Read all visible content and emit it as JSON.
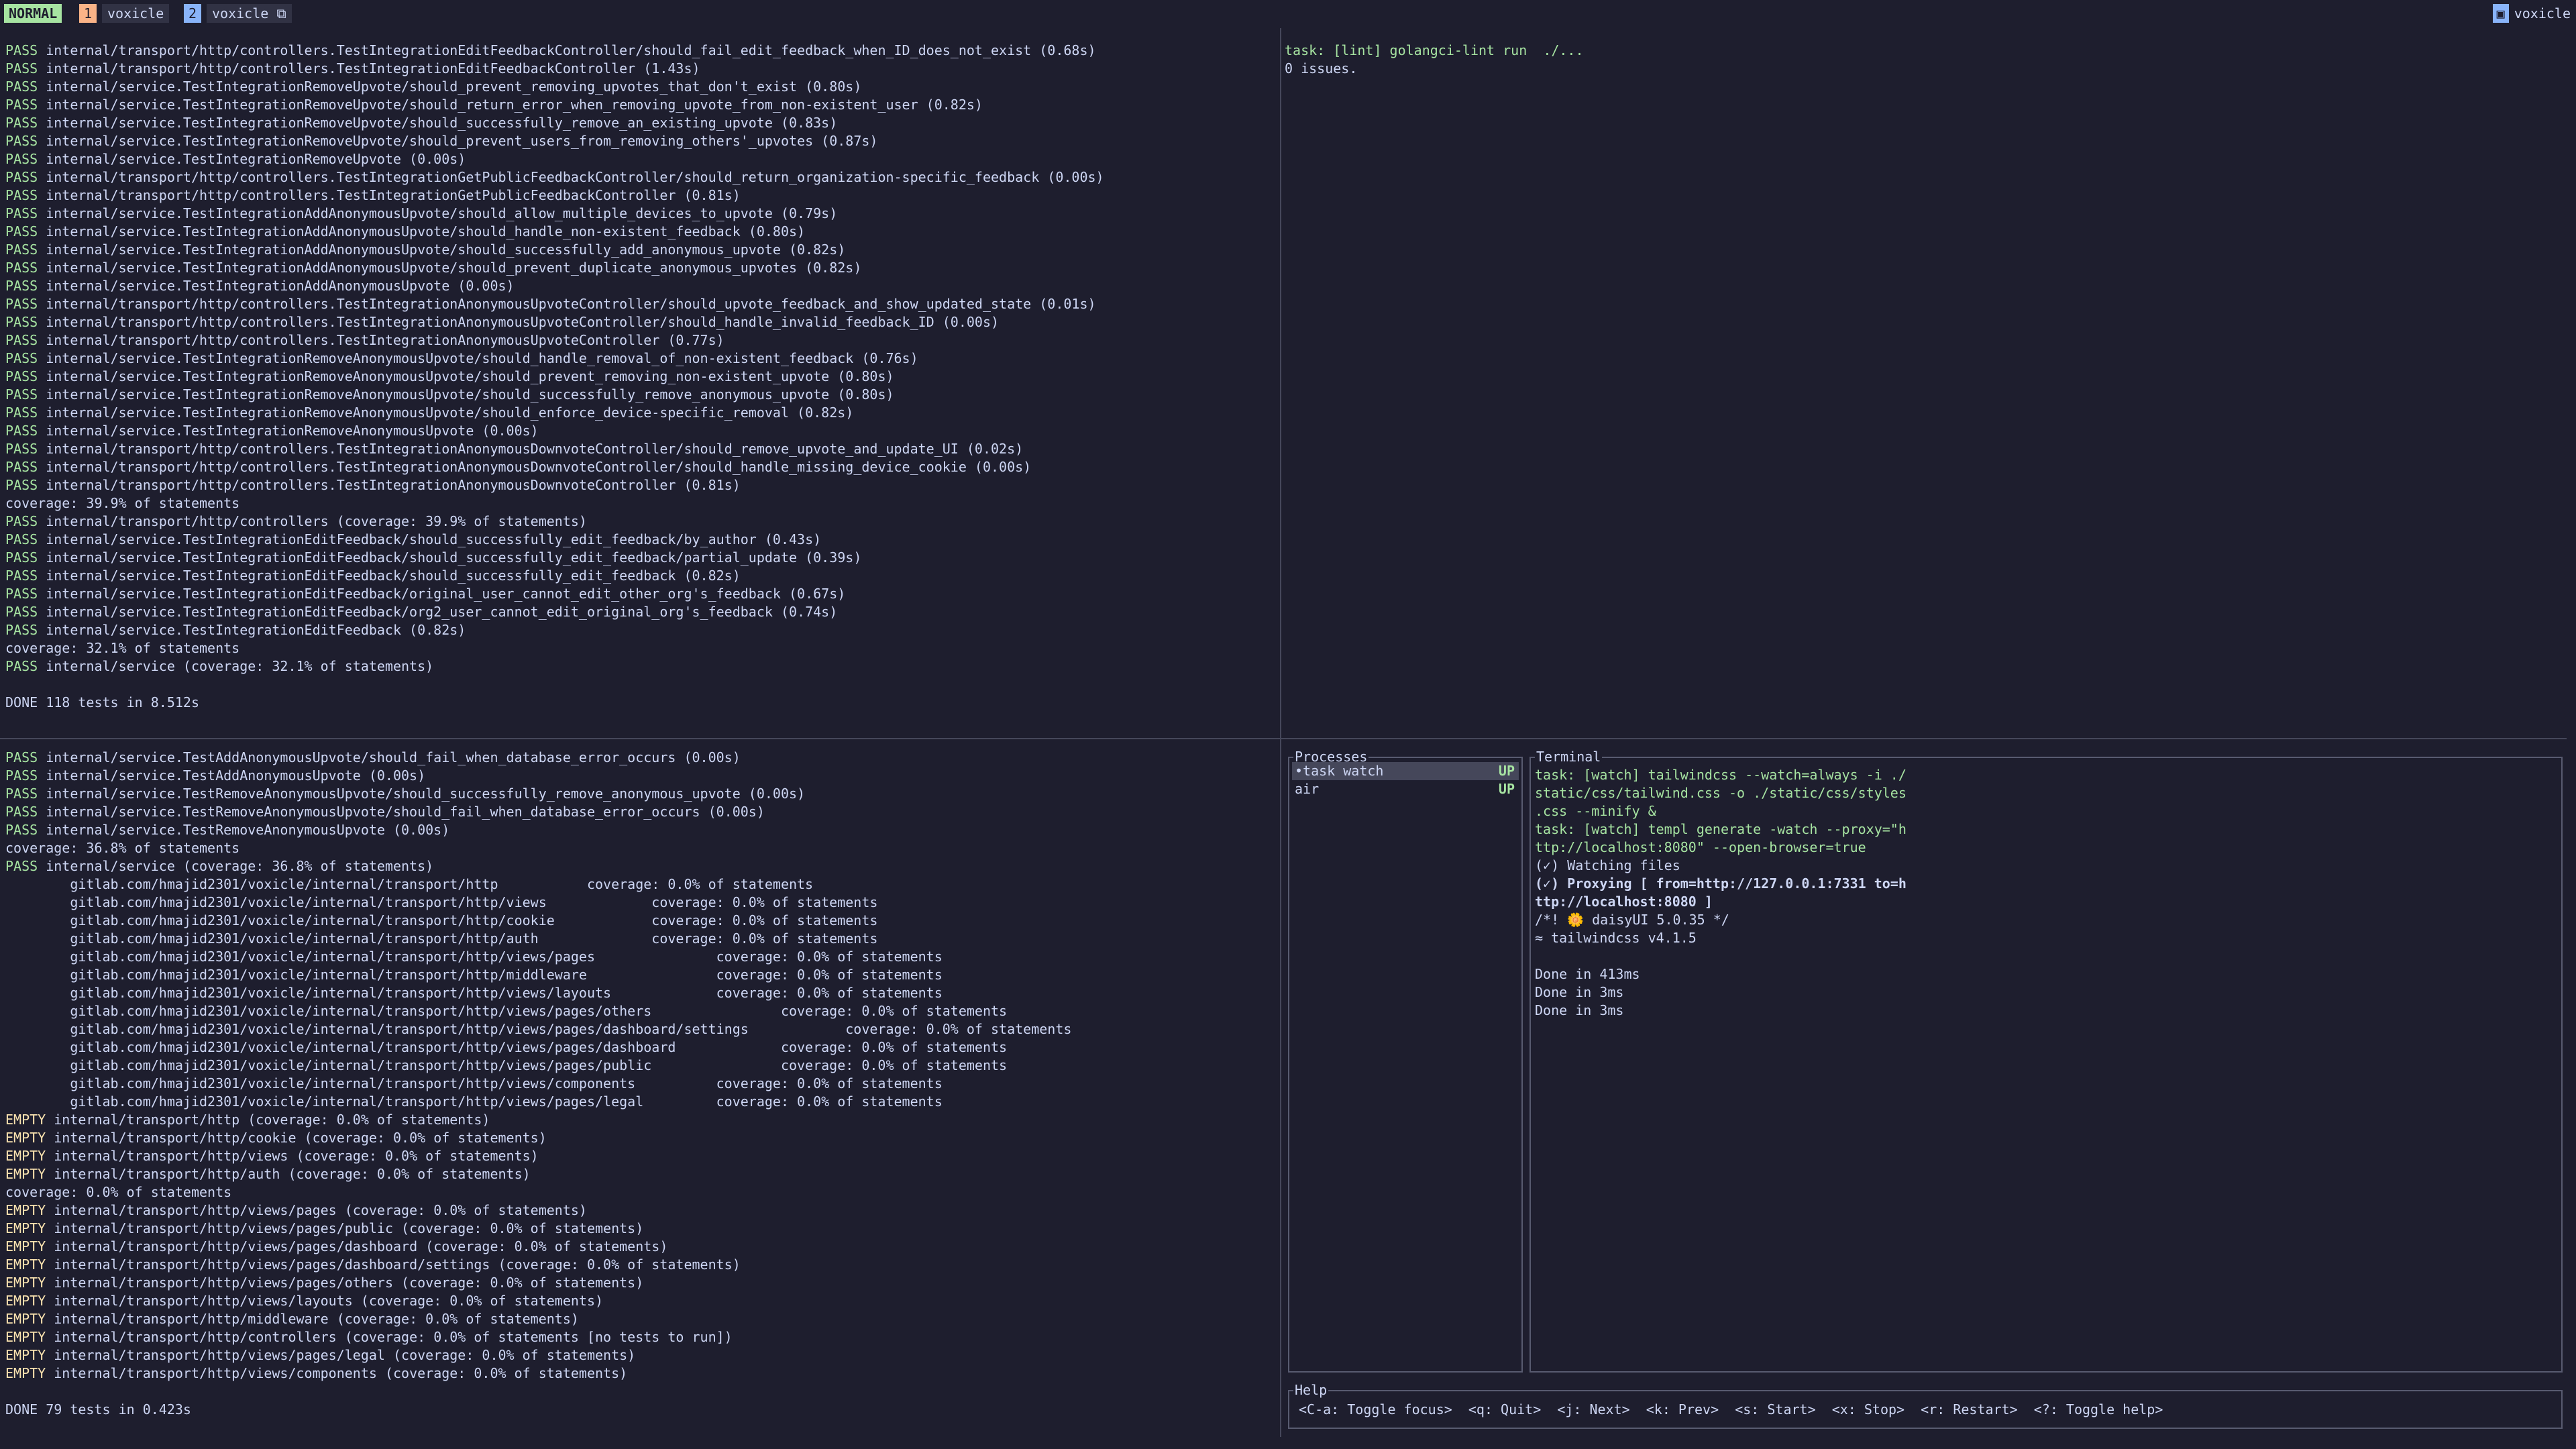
{
  "topbar": {
    "mode": "NORMAL",
    "window1_num": "1",
    "window1_name": "voxicle",
    "window2_num": "2",
    "window2_name": "voxicle ⧉",
    "session_icon": "▣",
    "session_name": "voxicle"
  },
  "top_left_lines": [
    {
      "s": "PASS",
      "t": " internal/transport/http/controllers.TestIntegrationEditFeedbackController/should_fail_edit_feedback_when_ID_does_not_exist (0.68s)"
    },
    {
      "s": "PASS",
      "t": " internal/transport/http/controllers.TestIntegrationEditFeedbackController (1.43s)"
    },
    {
      "s": "PASS",
      "t": " internal/service.TestIntegrationRemoveUpvote/should_prevent_removing_upvotes_that_don't_exist (0.80s)"
    },
    {
      "s": "PASS",
      "t": " internal/service.TestIntegrationRemoveUpvote/should_return_error_when_removing_upvote_from_non-existent_user (0.82s)"
    },
    {
      "s": "PASS",
      "t": " internal/service.TestIntegrationRemoveUpvote/should_successfully_remove_an_existing_upvote (0.83s)"
    },
    {
      "s": "PASS",
      "t": " internal/service.TestIntegrationRemoveUpvote/should_prevent_users_from_removing_others'_upvotes (0.87s)"
    },
    {
      "s": "PASS",
      "t": " internal/service.TestIntegrationRemoveUpvote (0.00s)"
    },
    {
      "s": "PASS",
      "t": " internal/transport/http/controllers.TestIntegrationGetPublicFeedbackController/should_return_organization-specific_feedback (0.00s)"
    },
    {
      "s": "PASS",
      "t": " internal/transport/http/controllers.TestIntegrationGetPublicFeedbackController (0.81s)"
    },
    {
      "s": "PASS",
      "t": " internal/service.TestIntegrationAddAnonymousUpvote/should_allow_multiple_devices_to_upvote (0.79s)"
    },
    {
      "s": "PASS",
      "t": " internal/service.TestIntegrationAddAnonymousUpvote/should_handle_non-existent_feedback (0.80s)"
    },
    {
      "s": "PASS",
      "t": " internal/service.TestIntegrationAddAnonymousUpvote/should_successfully_add_anonymous_upvote (0.82s)"
    },
    {
      "s": "PASS",
      "t": " internal/service.TestIntegrationAddAnonymousUpvote/should_prevent_duplicate_anonymous_upvotes (0.82s)"
    },
    {
      "s": "PASS",
      "t": " internal/service.TestIntegrationAddAnonymousUpvote (0.00s)"
    },
    {
      "s": "PASS",
      "t": " internal/transport/http/controllers.TestIntegrationAnonymousUpvoteController/should_upvote_feedback_and_show_updated_state (0.01s)"
    },
    {
      "s": "PASS",
      "t": " internal/transport/http/controllers.TestIntegrationAnonymousUpvoteController/should_handle_invalid_feedback_ID (0.00s)"
    },
    {
      "s": "PASS",
      "t": " internal/transport/http/controllers.TestIntegrationAnonymousUpvoteController (0.77s)"
    },
    {
      "s": "PASS",
      "t": " internal/service.TestIntegrationRemoveAnonymousUpvote/should_handle_removal_of_non-existent_feedback (0.76s)"
    },
    {
      "s": "PASS",
      "t": " internal/service.TestIntegrationRemoveAnonymousUpvote/should_prevent_removing_non-existent_upvote (0.80s)"
    },
    {
      "s": "PASS",
      "t": " internal/service.TestIntegrationRemoveAnonymousUpvote/should_successfully_remove_anonymous_upvote (0.80s)"
    },
    {
      "s": "PASS",
      "t": " internal/service.TestIntegrationRemoveAnonymousUpvote/should_enforce_device-specific_removal (0.82s)"
    },
    {
      "s": "PASS",
      "t": " internal/service.TestIntegrationRemoveAnonymousUpvote (0.00s)"
    },
    {
      "s": "PASS",
      "t": " internal/transport/http/controllers.TestIntegrationAnonymousDownvoteController/should_remove_upvote_and_update_UI (0.02s)"
    },
    {
      "s": "PASS",
      "t": " internal/transport/http/controllers.TestIntegrationAnonymousDownvoteController/should_handle_missing_device_cookie (0.00s)"
    },
    {
      "s": "PASS",
      "t": " internal/transport/http/controllers.TestIntegrationAnonymousDownvoteController (0.81s)"
    },
    {
      "s": "",
      "t": "coverage: 39.9% of statements"
    },
    {
      "s": "PASS",
      "t": " internal/transport/http/controllers (coverage: 39.9% of statements)"
    },
    {
      "s": "PASS",
      "t": " internal/service.TestIntegrationEditFeedback/should_successfully_edit_feedback/by_author (0.43s)"
    },
    {
      "s": "PASS",
      "t": " internal/service.TestIntegrationEditFeedback/should_successfully_edit_feedback/partial_update (0.39s)"
    },
    {
      "s": "PASS",
      "t": " internal/service.TestIntegrationEditFeedback/should_successfully_edit_feedback (0.82s)"
    },
    {
      "s": "PASS",
      "t": " internal/service.TestIntegrationEditFeedback/original_user_cannot_edit_other_org's_feedback (0.67s)"
    },
    {
      "s": "PASS",
      "t": " internal/service.TestIntegrationEditFeedback/org2_user_cannot_edit_original_org's_feedback (0.74s)"
    },
    {
      "s": "PASS",
      "t": " internal/service.TestIntegrationEditFeedback (0.82s)"
    },
    {
      "s": "",
      "t": "coverage: 32.1% of statements"
    },
    {
      "s": "PASS",
      "t": " internal/service (coverage: 32.1% of statements)"
    },
    {
      "s": "",
      "t": ""
    },
    {
      "s": "",
      "t": "DONE 118 tests in 8.512s"
    }
  ],
  "top_right_lines": [
    {
      "t": "task: [lint] golangci-lint run  ./...",
      "c": "green"
    },
    {
      "t": "0 issues.",
      "c": "muted"
    }
  ],
  "bottom_left_lines": [
    {
      "s": "PASS",
      "t": " internal/service.TestAddAnonymousUpvote/should_fail_when_database_error_occurs (0.00s)"
    },
    {
      "s": "PASS",
      "t": " internal/service.TestAddAnonymousUpvote (0.00s)"
    },
    {
      "s": "PASS",
      "t": " internal/service.TestRemoveAnonymousUpvote/should_successfully_remove_anonymous_upvote (0.00s)"
    },
    {
      "s": "PASS",
      "t": " internal/service.TestRemoveAnonymousUpvote/should_fail_when_database_error_occurs (0.00s)"
    },
    {
      "s": "PASS",
      "t": " internal/service.TestRemoveAnonymousUpvote (0.00s)"
    },
    {
      "s": "",
      "t": "coverage: 36.8% of statements"
    },
    {
      "s": "PASS",
      "t": " internal/service (coverage: 36.8% of statements)"
    },
    {
      "s": "",
      "t": "        gitlab.com/hmajid2301/voxicle/internal/transport/http           coverage: 0.0% of statements"
    },
    {
      "s": "",
      "t": "        gitlab.com/hmajid2301/voxicle/internal/transport/http/views             coverage: 0.0% of statements"
    },
    {
      "s": "",
      "t": "        gitlab.com/hmajid2301/voxicle/internal/transport/http/cookie            coverage: 0.0% of statements"
    },
    {
      "s": "",
      "t": "        gitlab.com/hmajid2301/voxicle/internal/transport/http/auth              coverage: 0.0% of statements"
    },
    {
      "s": "",
      "t": "        gitlab.com/hmajid2301/voxicle/internal/transport/http/views/pages               coverage: 0.0% of statements"
    },
    {
      "s": "",
      "t": "        gitlab.com/hmajid2301/voxicle/internal/transport/http/middleware                coverage: 0.0% of statements"
    },
    {
      "s": "",
      "t": "        gitlab.com/hmajid2301/voxicle/internal/transport/http/views/layouts             coverage: 0.0% of statements"
    },
    {
      "s": "",
      "t": "        gitlab.com/hmajid2301/voxicle/internal/transport/http/views/pages/others                coverage: 0.0% of statements"
    },
    {
      "s": "",
      "t": "        gitlab.com/hmajid2301/voxicle/internal/transport/http/views/pages/dashboard/settings            coverage: 0.0% of statements"
    },
    {
      "s": "",
      "t": "        gitlab.com/hmajid2301/voxicle/internal/transport/http/views/pages/dashboard             coverage: 0.0% of statements"
    },
    {
      "s": "",
      "t": "        gitlab.com/hmajid2301/voxicle/internal/transport/http/views/pages/public                coverage: 0.0% of statements"
    },
    {
      "s": "",
      "t": "        gitlab.com/hmajid2301/voxicle/internal/transport/http/views/components          coverage: 0.0% of statements"
    },
    {
      "s": "",
      "t": "        gitlab.com/hmajid2301/voxicle/internal/transport/http/views/pages/legal         coverage: 0.0% of statements"
    },
    {
      "s": "EMPTY",
      "t": " internal/transport/http (coverage: 0.0% of statements)"
    },
    {
      "s": "EMPTY",
      "t": " internal/transport/http/cookie (coverage: 0.0% of statements)"
    },
    {
      "s": "EMPTY",
      "t": " internal/transport/http/views (coverage: 0.0% of statements)"
    },
    {
      "s": "EMPTY",
      "t": " internal/transport/http/auth (coverage: 0.0% of statements)"
    },
    {
      "s": "",
      "t": "coverage: 0.0% of statements"
    },
    {
      "s": "EMPTY",
      "t": " internal/transport/http/views/pages (coverage: 0.0% of statements)"
    },
    {
      "s": "EMPTY",
      "t": " internal/transport/http/views/pages/public (coverage: 0.0% of statements)"
    },
    {
      "s": "EMPTY",
      "t": " internal/transport/http/views/pages/dashboard (coverage: 0.0% of statements)"
    },
    {
      "s": "EMPTY",
      "t": " internal/transport/http/views/pages/dashboard/settings (coverage: 0.0% of statements)"
    },
    {
      "s": "EMPTY",
      "t": " internal/transport/http/views/pages/others (coverage: 0.0% of statements)"
    },
    {
      "s": "EMPTY",
      "t": " internal/transport/http/views/layouts (coverage: 0.0% of statements)"
    },
    {
      "s": "EMPTY",
      "t": " internal/transport/http/middleware (coverage: 0.0% of statements)"
    },
    {
      "s": "EMPTY",
      "t": " internal/transport/http/controllers (coverage: 0.0% of statements [no tests to run])"
    },
    {
      "s": "EMPTY",
      "t": " internal/transport/http/views/pages/legal (coverage: 0.0% of statements)"
    },
    {
      "s": "EMPTY",
      "t": " internal/transport/http/views/components (coverage: 0.0% of statements)"
    },
    {
      "s": "",
      "t": ""
    },
    {
      "s": "",
      "t": "DONE 79 tests in 0.423s"
    }
  ],
  "processes": {
    "title": "Processes",
    "items": [
      {
        "name": "•task watch",
        "status": "UP"
      },
      {
        "name": " air",
        "status": "UP"
      }
    ]
  },
  "terminal": {
    "title": "Terminal",
    "lines": [
      {
        "t": "task: [watch] tailwindcss --watch=always -i ./",
        "c": "green"
      },
      {
        "t": "static/css/tailwind.css -o ./static/css/styles",
        "c": "green"
      },
      {
        "t": ".css --minify &",
        "c": "green"
      },
      {
        "t": "task: [watch] templ generate -watch --proxy=\"h",
        "c": "green"
      },
      {
        "t": "ttp://localhost:8080\" --open-browser=true",
        "c": "green"
      },
      {
        "t": "(✓) Watching files",
        "c": "muted"
      },
      {
        "t": "(✓) Proxying [ from=http://127.0.0.1:7331 to=h",
        "c": "muted",
        "bold": true
      },
      {
        "t": "ttp://localhost:8080 ]",
        "c": "muted",
        "bold": true
      },
      {
        "t": "/*! 🌼 daisyUI 5.0.35 */",
        "c": "muted"
      },
      {
        "t": "≈ tailwindcss v4.1.5",
        "c": "muted"
      },
      {
        "t": "",
        "c": "muted"
      },
      {
        "t": "Done in 413ms",
        "c": "muted"
      },
      {
        "t": "Done in 3ms",
        "c": "muted"
      },
      {
        "t": "Done in 3ms",
        "c": "muted"
      }
    ]
  },
  "help": {
    "title": "Help",
    "text": "<C-a: Toggle focus>  <q: Quit>  <j: Next>  <k: Prev>  <s: Start>  <x: Stop>  <r: Restart>  <?: Toggle help>"
  }
}
